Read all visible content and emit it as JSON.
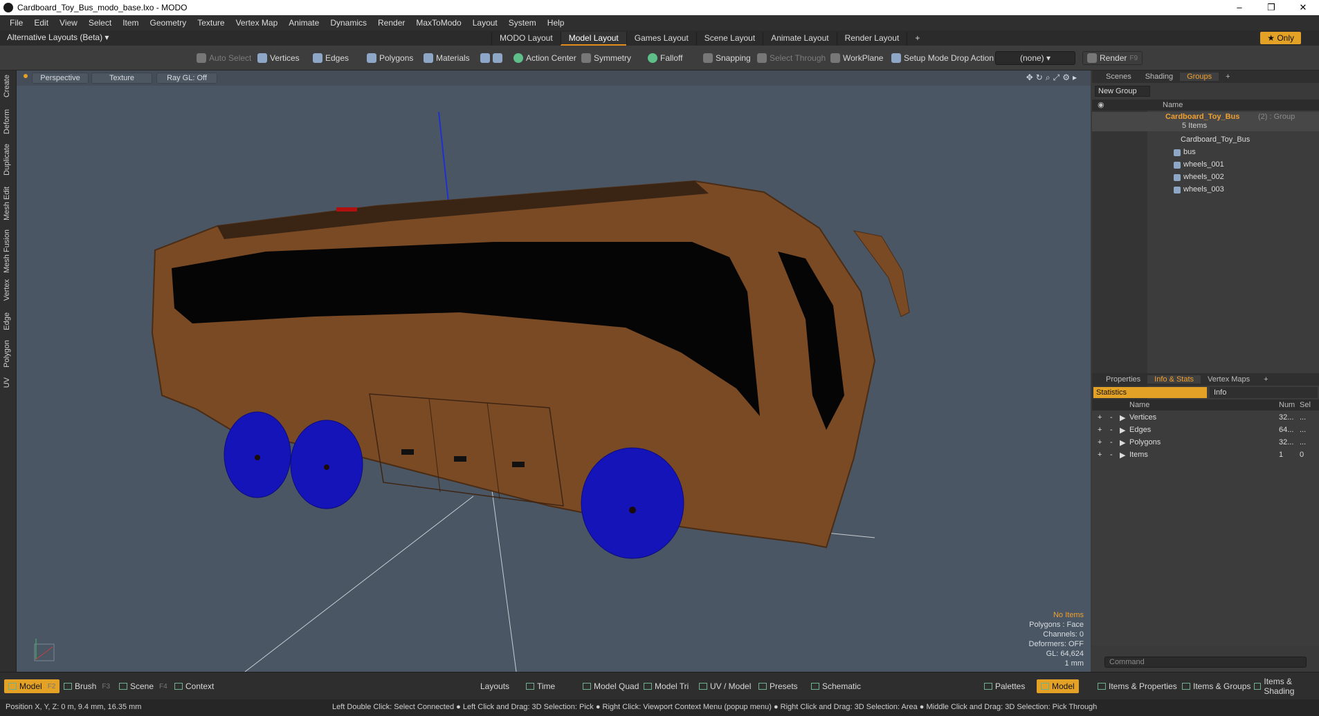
{
  "window": {
    "title": "Cardboard_Toy_Bus_modo_base.lxo - MODO",
    "controls": [
      "–",
      "❐",
      "✕"
    ]
  },
  "menu": [
    "File",
    "Edit",
    "View",
    "Select",
    "Item",
    "Geometry",
    "Texture",
    "Vertex Map",
    "Animate",
    "Dynamics",
    "Render",
    "MaxToModo",
    "Layout",
    "System",
    "Help"
  ],
  "layouts": {
    "alternative": "Alternative Layouts (Beta) ▾",
    "tabs": [
      "MODO Layout",
      "Model Layout",
      "Games Layout",
      "Scene Layout",
      "Animate Layout",
      "Render Layout"
    ],
    "active_tab": "Model Layout",
    "add": "+",
    "only": "★ Only"
  },
  "toolbar": {
    "auto_select": "Auto Select",
    "vertices": "Vertices",
    "edges": "Edges",
    "polygons": "Polygons",
    "materials": "Materials",
    "action_center": "Action Center",
    "symmetry": "Symmetry",
    "falloff": "Falloff",
    "snapping": "Snapping",
    "select_through": "Select Through",
    "workplane": "WorkPlane",
    "setup_mode": "Setup Mode",
    "drop_action": "Drop Action",
    "drop_value": "(none)",
    "render": "Render",
    "render_key": "F9"
  },
  "left_tabs": [
    "Create",
    "Deform",
    "Duplicate",
    "Mesh Edit",
    "Mesh Fusion",
    "Vertex",
    "Edge",
    "Polygon",
    "UV"
  ],
  "viewport": {
    "view": "Perspective",
    "shading": "Texture",
    "raygl": "Ray GL: Off",
    "info": {
      "items": "No Items",
      "polygons": "Polygons : Face",
      "channels": "Channels: 0",
      "deformers": "Deformers: OFF",
      "gl": "GL: 64,624",
      "unit": "1 mm"
    },
    "colors": {
      "background": "#4a5663",
      "body": "#7a4a25",
      "wheel": "#1414b8"
    }
  },
  "groups_panel": {
    "tabs": [
      "Scenes",
      "Shading",
      "Groups"
    ],
    "active": "Groups",
    "new_group": "New Group",
    "col_name": "Name",
    "group_name": "Cardboard_Toy_Bus",
    "group_suffix": "(2) : Group",
    "group_count": "5 Items",
    "items": [
      "Cardboard_Toy_Bus",
      "bus",
      "wheels_001",
      "wheels_002",
      "wheels_003"
    ]
  },
  "stats_panel": {
    "tabs": [
      "Properties",
      "Info & Stats",
      "Vertex Maps"
    ],
    "active": "Info & Stats",
    "subtabs": [
      "Statistics",
      "Info"
    ],
    "cols": [
      "Name",
      "Num",
      "Sel"
    ],
    "rows": [
      {
        "name": "Vertices",
        "num": "32...",
        "sel": "..."
      },
      {
        "name": "Edges",
        "num": "64...",
        "sel": "..."
      },
      {
        "name": "Polygons",
        "num": "32...",
        "sel": "..."
      },
      {
        "name": "Items",
        "num": "1",
        "sel": "0"
      }
    ]
  },
  "command": "Command",
  "bottom": {
    "model": "Model",
    "model_key": "F2",
    "brush": "Brush",
    "brush_key": "F3",
    "scene": "Scene",
    "scene_key": "F4",
    "context": "Context",
    "layouts": "Layouts",
    "time": "Time",
    "model_quad": "Model Quad",
    "model_tri": "Model Tri",
    "uv_model": "UV / Model",
    "presets": "Presets",
    "schematic": "Schematic",
    "palettes": "Palettes",
    "model2": "Model",
    "items_props": "Items & Properties",
    "items_groups": "Items & Groups",
    "items_shading": "Items & Shading"
  },
  "status": {
    "position": "Position X, Y, Z:   0 m, 9.4 mm, 16.35 mm",
    "hints": "Left Double Click: Select Connected ● Left Click and Drag: 3D Selection: Pick ● Right Click: Viewport Context Menu (popup menu) ● Right Click and Drag: 3D Selection: Area ● Middle Click and Drag: 3D Selection: Pick Through"
  }
}
